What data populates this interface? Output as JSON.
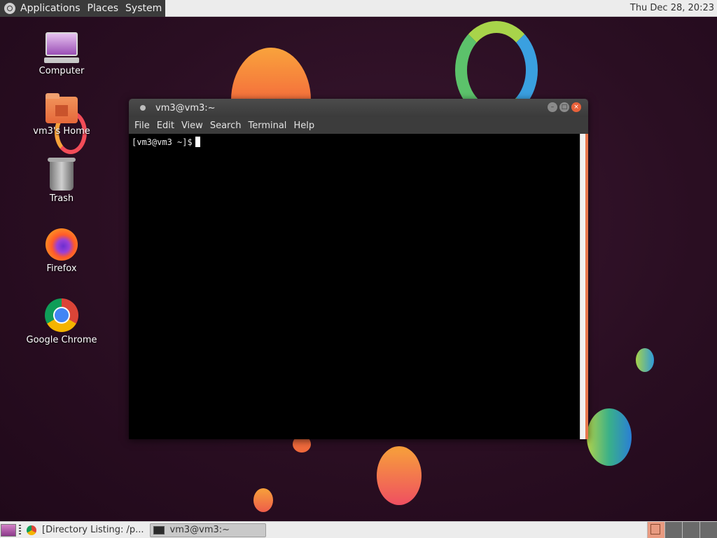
{
  "top_panel": {
    "menus": [
      "Applications",
      "Places",
      "System"
    ],
    "clock": "Thu Dec 28, 20:23"
  },
  "desktop_icons": [
    {
      "label": "Computer",
      "icon": "computer-icon"
    },
    {
      "label": "vm3's Home",
      "icon": "home-folder-icon"
    },
    {
      "label": "Trash",
      "icon": "trash-icon"
    },
    {
      "label": "Firefox",
      "icon": "firefox-icon"
    },
    {
      "label": "Google Chrome",
      "icon": "chrome-icon"
    }
  ],
  "terminal": {
    "title": "vm3@vm3:~",
    "menu": [
      "File",
      "Edit",
      "View",
      "Search",
      "Terminal",
      "Help"
    ],
    "prompt": "[vm3@vm3 ~]$"
  },
  "taskbar": {
    "tasks": [
      {
        "label": "[Directory Listing: /p...",
        "icon": "chrome-icon",
        "active": false
      },
      {
        "label": "vm3@vm3:~",
        "icon": "terminal-icon",
        "active": true
      }
    ]
  },
  "colors": {
    "panel_bg": "#ececec",
    "wallpaper_bg": "#2a0e22",
    "terminal_bg": "#000000",
    "close_button": "#e9613a"
  }
}
